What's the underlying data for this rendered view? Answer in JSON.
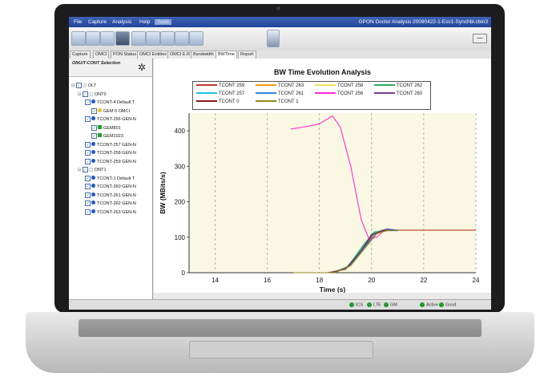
{
  "window": {
    "title": "GPON Doctor Analysis 20090422-1-Esc1-Synchbl.cbin3",
    "menu": [
      "File",
      "Capture",
      "Analysis",
      "Help",
      "Tools"
    ]
  },
  "toolbar": {
    "minimize_label": "—"
  },
  "tabs": [
    "Capture",
    "OMCI",
    "PON Status",
    "OMCI Entities",
    "OMCI E.R",
    "Bandwidth",
    "BWTime",
    "Report"
  ],
  "active_tab": "BWTime",
  "sidebar": {
    "title": "ONU/T-CONT Selection",
    "tree": [
      {
        "label": "OLT",
        "indent": 0,
        "dot": ""
      },
      {
        "label": "ONT0",
        "indent": 1,
        "dot": ""
      },
      {
        "label": "TCONT-4 Default T",
        "indent": 2,
        "dot": "#1a57d6"
      },
      {
        "label": "GEM 0 OMCI",
        "indent": 3,
        "dot": "#e8c21a"
      },
      {
        "label": "TCONT-256 GEN-N",
        "indent": 2,
        "dot": "#1a57d6"
      },
      {
        "label": "GEM801",
        "indent": 3,
        "dot": "#22a022",
        "square": true
      },
      {
        "label": "GEM1023",
        "indent": 3,
        "dot": "#22a022",
        "square": true
      },
      {
        "label": "TCONT-257 GEN-N",
        "indent": 2,
        "dot": "#1a57d6"
      },
      {
        "label": "TCONT-258 GEN-N",
        "indent": 2,
        "dot": "#1a57d6"
      },
      {
        "label": "TCONT-259 GEN-N",
        "indent": 2,
        "dot": "#1a57d6"
      },
      {
        "label": "ONT1",
        "indent": 1,
        "dot": ""
      },
      {
        "label": "TCONT-1 Default T",
        "indent": 2,
        "dot": "#1a57d6"
      },
      {
        "label": "TCONT-260 GEN-N",
        "indent": 2,
        "dot": "#1a57d6"
      },
      {
        "label": "TCONT-261 GEN-N",
        "indent": 2,
        "dot": "#1a57d6"
      },
      {
        "label": "TCONT-262 GEN-N",
        "indent": 2,
        "dot": "#1a57d6"
      },
      {
        "label": "TCONT-263 GEN-N",
        "indent": 2,
        "dot": "#1a57d6"
      }
    ]
  },
  "status": [
    {
      "label": "ICS",
      "color": "#1f9b2a"
    },
    {
      "label": "LTE",
      "color": "#1f9b2a"
    },
    {
      "label": "GM",
      "color": "#1f9b2a"
    },
    {
      "label": "Active",
      "color": "#1f9b2a"
    },
    {
      "label": "Good",
      "color": "#1f9b2a"
    }
  ],
  "chart_data": {
    "type": "line",
    "title": "BW Time Evolution Analysis",
    "xlabel": "Time (s)",
    "ylabel": "BW (MBits/s)",
    "xlim": [
      13,
      24
    ],
    "ylim": [
      0,
      450
    ],
    "xticks": [
      14,
      16,
      18,
      20,
      22,
      24
    ],
    "yticks": [
      0,
      100,
      200,
      300,
      400
    ],
    "grid": "x",
    "background": "#faf8e2",
    "legend_position": "top",
    "series": [
      {
        "name": "TCONT 259",
        "color": "#c0392b",
        "x": [
          17.0,
          18.3,
          19.0,
          19.6,
          20.0,
          20.4,
          21.0,
          24.0
        ],
        "y": [
          0,
          0,
          10,
          60,
          110,
          120,
          120,
          120
        ]
      },
      {
        "name": "TCONT 263",
        "color": "#f39c12",
        "x": [
          17.2,
          18.5,
          19.1,
          19.7,
          20.1,
          20.5,
          21.0
        ],
        "y": [
          0,
          0,
          15,
          70,
          112,
          122,
          120
        ]
      },
      {
        "name": "TCONT 258",
        "color": "#f1e05a",
        "x": [
          17.2,
          18.6,
          19.2,
          19.8,
          20.2,
          20.6,
          21.0
        ],
        "y": [
          0,
          0,
          20,
          75,
          110,
          120,
          118
        ]
      },
      {
        "name": "TCONT 262",
        "color": "#27ae60",
        "x": [
          17.2,
          18.5,
          19.1,
          19.7,
          20.1,
          20.5,
          21.0
        ],
        "y": [
          0,
          0,
          18,
          80,
          115,
          118,
          120
        ]
      },
      {
        "name": "TCONT 257",
        "color": "#17c6e8",
        "x": [
          17.2,
          18.4,
          19.0,
          19.6,
          20.0,
          20.4,
          21.0
        ],
        "y": [
          0,
          0,
          12,
          65,
          108,
          120,
          118
        ]
      },
      {
        "name": "TCONT 261",
        "color": "#2e86de",
        "x": [
          17.2,
          18.6,
          19.2,
          19.8,
          20.2,
          20.6,
          21.0
        ],
        "y": [
          0,
          0,
          22,
          78,
          112,
          124,
          120
        ]
      },
      {
        "name": "TCONT 256",
        "color": "#ff2ad4",
        "x": [
          16.9,
          17.5,
          18.0,
          18.5,
          18.8,
          19.2,
          19.6,
          19.9,
          20.2,
          20.5,
          20.8
        ],
        "y": [
          405,
          412,
          420,
          442,
          410,
          300,
          150,
          95,
          100,
          120,
          118
        ]
      },
      {
        "name": "TCONT 260",
        "color": "#7d3c98",
        "x": [
          17.2,
          18.5,
          19.1,
          19.7,
          20.1,
          20.5,
          21.0
        ],
        "y": [
          0,
          0,
          16,
          72,
          110,
          121,
          120
        ]
      },
      {
        "name": "TCONT 0",
        "color": "#8b1a1a",
        "x": [
          17.0,
          18.4,
          19.0,
          19.6,
          20.0,
          20.4,
          21.0
        ],
        "y": [
          0,
          0,
          10,
          62,
          106,
          118,
          120
        ]
      },
      {
        "name": "TCONT 1",
        "color": "#8a8a1e",
        "x": [
          17.0,
          18.6,
          19.2,
          19.8,
          20.2,
          20.6,
          21.0
        ],
        "y": [
          0,
          0,
          20,
          74,
          110,
          119,
          120
        ]
      }
    ]
  }
}
